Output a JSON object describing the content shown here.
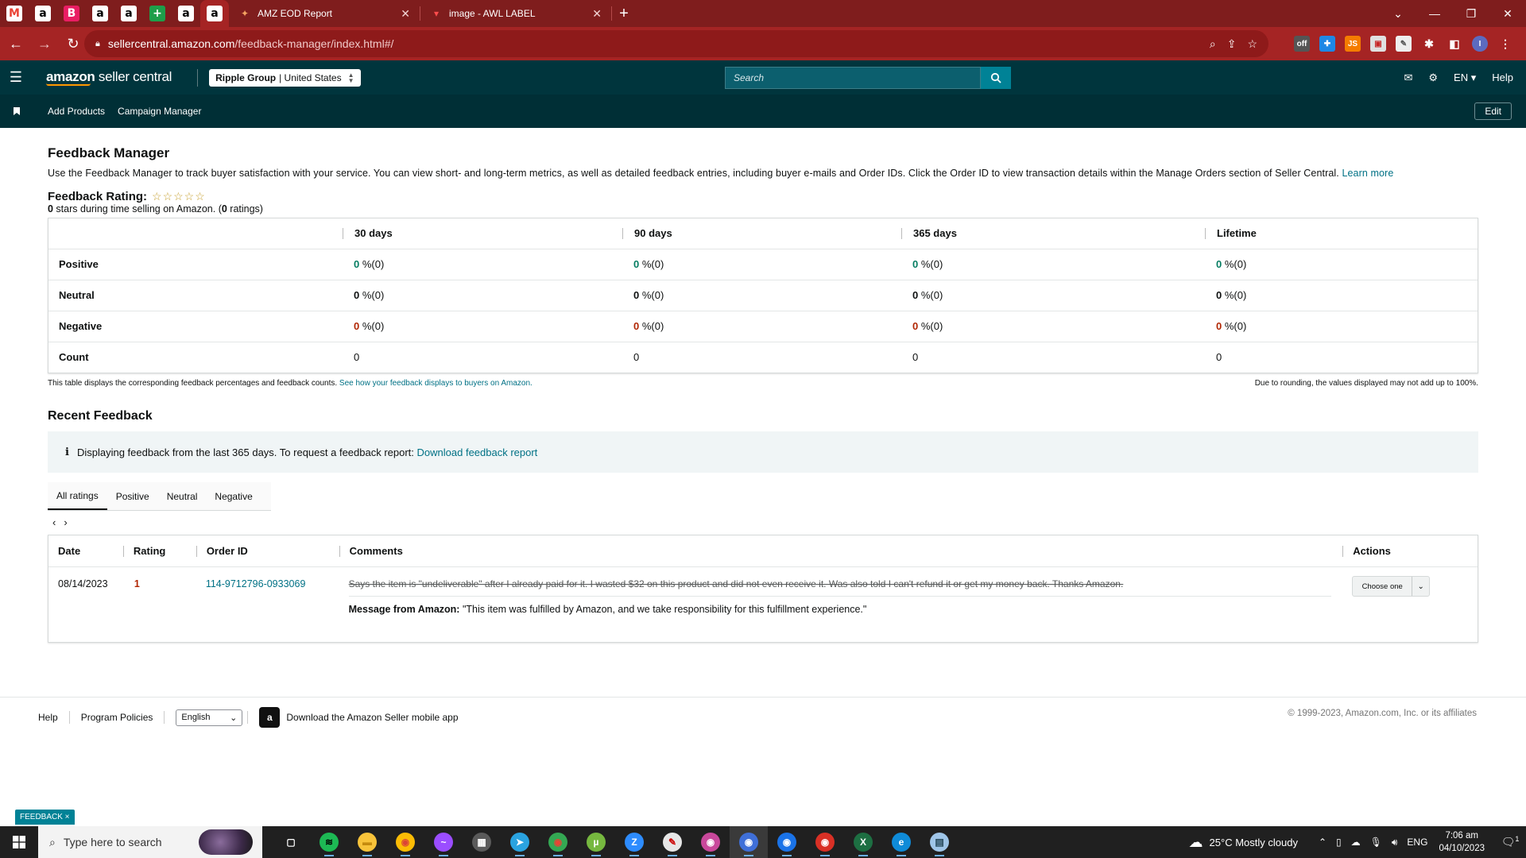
{
  "browser": {
    "tabs": [
      {
        "title": "AMZ EOD Report",
        "icon": "cloud-favicon"
      },
      {
        "title": "image - AWL LABEL",
        "icon": "red-favicon"
      }
    ],
    "pinned_tabs": [
      {
        "icon": "gmail",
        "glyph": "M",
        "color": "#ea4335",
        "bg": "#fff"
      },
      {
        "icon": "amazon",
        "glyph": "a",
        "color": "#000",
        "bg": "#fff"
      },
      {
        "icon": "b-app",
        "glyph": "B",
        "color": "#fff",
        "bg": "#e91e63"
      },
      {
        "icon": "amazon",
        "glyph": "a",
        "color": "#000",
        "bg": "#fff"
      },
      {
        "icon": "amazon",
        "glyph": "a",
        "color": "#000",
        "bg": "#fff"
      },
      {
        "icon": "sheets-plus",
        "glyph": "+",
        "color": "#fff",
        "bg": "#1e9e4a"
      },
      {
        "icon": "amazon",
        "glyph": "a",
        "color": "#000",
        "bg": "#fff"
      },
      {
        "icon": "amazon",
        "glyph": "a",
        "color": "#000",
        "bg": "#fff"
      }
    ],
    "url_host": "sellercentral.amazon.com",
    "url_path": "/feedback-manager/index.html#/"
  },
  "header": {
    "logo_bold": "amazon",
    "logo_rest": " seller central",
    "account_name": "Ripple Group",
    "account_region": "| United States",
    "search_placeholder": "Search",
    "language": "EN",
    "help": "Help"
  },
  "subnav": {
    "links": [
      "Add Products",
      "Campaign Manager"
    ],
    "edit": "Edit"
  },
  "page": {
    "title": "Feedback Manager",
    "intro": "Use the Feedback Manager to track buyer satisfaction with your service. You can view short- and long-term metrics, as well as detailed feedback entries, including buyer e-mails and Order IDs. Click the Order ID to view transaction details within the Manage Orders section of Seller Central.",
    "learn_more": "Learn more",
    "rating_label": "Feedback Rating:",
    "rating_stars": 0,
    "stars_glyphs": "☆☆☆☆☆",
    "rating_summary_stars": "0",
    "rating_summary_mid": " stars during time selling on Amazon. (",
    "rating_summary_count": "0",
    "rating_summary_end": " ratings)"
  },
  "metrics": {
    "columns": [
      "30 days",
      "90 days",
      "365 days",
      "Lifetime"
    ],
    "rows": [
      {
        "label": "Positive",
        "kind": "pos",
        "cells": [
          {
            "n": "0",
            "rest": " %(0)"
          },
          {
            "n": "0",
            "rest": " %(0)"
          },
          {
            "n": "0",
            "rest": " %(0)"
          },
          {
            "n": "0",
            "rest": " %(0)"
          }
        ]
      },
      {
        "label": "Neutral",
        "kind": "neu",
        "cells": [
          {
            "n": "0",
            "rest": " %(0)"
          },
          {
            "n": "0",
            "rest": " %(0)"
          },
          {
            "n": "0",
            "rest": " %(0)"
          },
          {
            "n": "0",
            "rest": " %(0)"
          }
        ]
      },
      {
        "label": "Negative",
        "kind": "neg",
        "cells": [
          {
            "n": "0",
            "rest": " %(0)"
          },
          {
            "n": "0",
            "rest": " %(0)"
          },
          {
            "n": "0",
            "rest": " %(0)"
          },
          {
            "n": "0",
            "rest": " %(0)"
          }
        ]
      },
      {
        "label": "Count",
        "kind": "count",
        "cells": [
          {
            "n": "",
            "rest": "0"
          },
          {
            "n": "",
            "rest": "0"
          },
          {
            "n": "",
            "rest": "0"
          },
          {
            "n": "",
            "rest": "0"
          }
        ]
      }
    ],
    "note_left": "This table displays the corresponding feedback percentages and feedback counts.",
    "note_left_link": "See how your feedback displays to buyers on Amazon.",
    "note_right": "Due to rounding, the values displayed may not add up to 100%."
  },
  "recent": {
    "title": "Recent Feedback",
    "info_text": "Displaying feedback from the last 365 days. To request a feedback report:",
    "info_link": "Download feedback report",
    "tabs": [
      "All ratings",
      "Positive",
      "Neutral",
      "Negative"
    ],
    "active_tab": "All ratings",
    "columns": [
      "Date",
      "Rating",
      "Order ID",
      "Comments",
      "Actions"
    ],
    "rows": [
      {
        "date": "08/14/2023",
        "rating": "1",
        "order_id": "114-9712796-0933069",
        "comment": "Says the item is \"undeliverable\" after I already paid for it. I wasted $32 on this product and did not even receive it. Was also told I can't refund it or get my money back. Thanks Amazon.",
        "message_label": "Message from Amazon:",
        "message": " \"This item was fulfilled by Amazon, and we take responsibility for this fulfillment experience.\"",
        "action": "Choose one"
      }
    ]
  },
  "footer": {
    "links": [
      "Help",
      "Program Policies"
    ],
    "language": "English",
    "app_text": "Download the Amazon Seller mobile app",
    "copyright": "© 1999-2023, Amazon.com, Inc. or its affiliates"
  },
  "feedback_chip": "FEEDBACK ×",
  "taskbar": {
    "search_placeholder": "Type here to search",
    "weather": "25°C  Mostly cloudy",
    "lang": "ENG",
    "time": "7:06 am",
    "date": "04/10/2023",
    "notification_count": "1",
    "apps": [
      {
        "name": "task-view",
        "glyph": "▢",
        "bg": "transparent",
        "color": "#fff"
      },
      {
        "name": "spotify",
        "glyph": "≋",
        "bg": "#1db954",
        "color": "#000"
      },
      {
        "name": "file-explorer",
        "glyph": "▬",
        "bg": "#f8c33a",
        "color": "#c48a0e"
      },
      {
        "name": "chrome",
        "glyph": "◉",
        "bg": "#fbbc05",
        "color": "#db4437"
      },
      {
        "name": "messenger",
        "glyph": "~",
        "bg": "#9b4dff",
        "color": "#fff"
      },
      {
        "name": "calculator",
        "glyph": "▦",
        "bg": "#5a5a5a",
        "color": "#fff"
      },
      {
        "name": "telegram",
        "glyph": "➤",
        "bg": "#2aa3e0",
        "color": "#fff"
      },
      {
        "name": "chrome-profile",
        "glyph": "◉",
        "bg": "#34a853",
        "color": "#ea4335"
      },
      {
        "name": "utorrent",
        "glyph": "µ",
        "bg": "#76b83f",
        "color": "#fff"
      },
      {
        "name": "zoom",
        "glyph": "Z",
        "bg": "#2d8cff",
        "color": "#fff"
      },
      {
        "name": "paint",
        "glyph": "✎",
        "bg": "#e7e7e7",
        "color": "#c00"
      },
      {
        "name": "chrome-c",
        "glyph": "◉",
        "bg": "#c9489b",
        "color": "#fff"
      },
      {
        "name": "chrome-i",
        "glyph": "◉",
        "bg": "#3f6fd8",
        "color": "#fff"
      },
      {
        "name": "chrome-s",
        "glyph": "◉",
        "bg": "#1a73e8",
        "color": "#fff"
      },
      {
        "name": "chrome-h",
        "glyph": "◉",
        "bg": "#d93025",
        "color": "#fff"
      },
      {
        "name": "excel",
        "glyph": "X",
        "bg": "#1d6f42",
        "color": "#fff"
      },
      {
        "name": "edge",
        "glyph": "e",
        "bg": "#0f8bd8",
        "color": "#fff"
      },
      {
        "name": "notepad",
        "glyph": "▤",
        "bg": "#9fc5e8",
        "color": "#245"
      }
    ]
  }
}
